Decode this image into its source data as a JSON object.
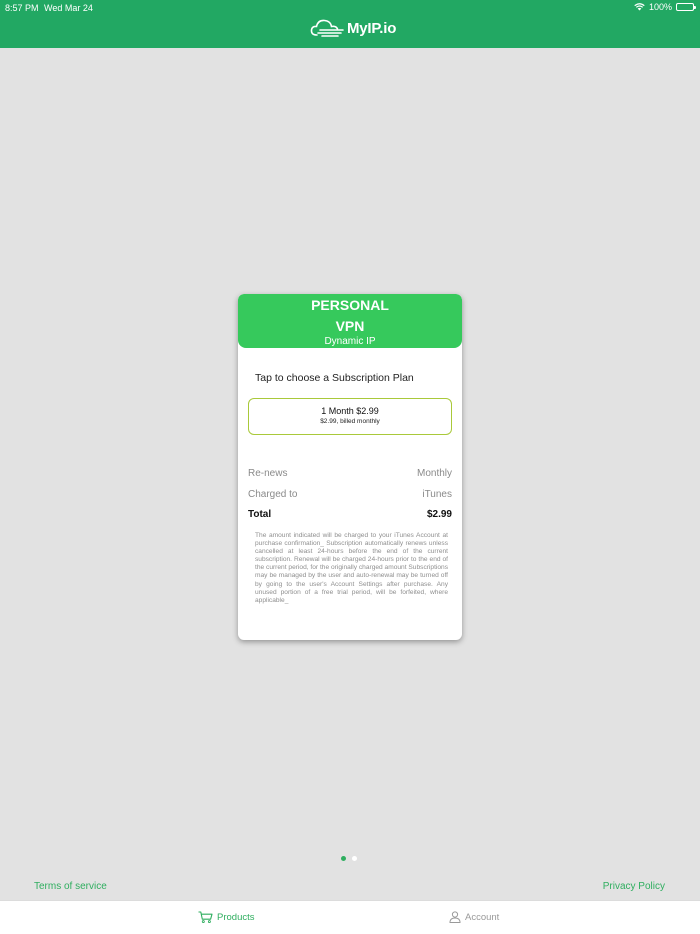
{
  "status_bar": {
    "time": "8:57 PM",
    "date": "Wed Mar 24",
    "battery": "100%"
  },
  "app": {
    "logo_text": "MyIP.io",
    "brand_color": "#22a863"
  },
  "card": {
    "title_line1": "PERSONAL",
    "title_line2": "VPN",
    "subtitle": "Dynamic IP",
    "prompt": "Tap to choose a Subscription Plan",
    "plan": {
      "name": "1 Month $2.99",
      "description": "$2.99, billed monthly"
    },
    "details": [
      {
        "label": "Re-news",
        "value": "Monthly"
      },
      {
        "label": "Charged to",
        "value": "iTunes"
      },
      {
        "label": "Total",
        "value": "$2.99"
      }
    ],
    "legal_text": "The amount indicated will be charged to your iTunes Account at purchase confirmation_ Subscription automatically renews unless cancelled at least 24-hours before the end of the current subscription. Renewal will be charged 24-hours prior to the end of the current period, for the originally charged amount Subscriptions may be managed by the user and auto-renewal may be turned off by going to the user's Account Settings after purchase. Any unused portion of a free trial period, will be forfeited, where applicable_"
  },
  "pager": {
    "active_index": 0,
    "count": 2
  },
  "footer": {
    "terms": "Terms of service",
    "privacy": "Privacy Policy"
  },
  "tabs": [
    {
      "label": "Products",
      "icon": "cart-icon",
      "active": true
    },
    {
      "label": "Account",
      "icon": "person-icon",
      "active": false
    }
  ]
}
